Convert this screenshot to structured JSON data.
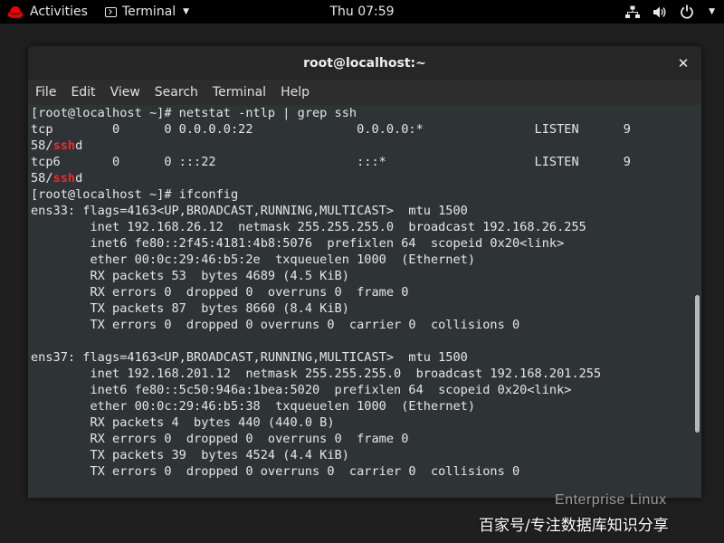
{
  "topbar": {
    "activities": "Activities",
    "app_name": "Terminal",
    "clock": "Thu 07:59"
  },
  "window": {
    "title": "root@localhost:~"
  },
  "menubar": {
    "items": [
      "File",
      "Edit",
      "View",
      "Search",
      "Terminal",
      "Help"
    ]
  },
  "terminal": {
    "lines": [
      [
        {
          "t": "[root@localhost ~]# netstat -ntlp | grep ssh"
        }
      ],
      [
        {
          "t": "tcp        0      0 0.0.0.0:22              0.0.0.0:*               LISTEN      9"
        }
      ],
      [
        {
          "t": "58/"
        },
        {
          "t": "ssh",
          "hl": true
        },
        {
          "t": "d"
        }
      ],
      [
        {
          "t": "tcp6       0      0 :::22                   :::*                    LISTEN      9"
        }
      ],
      [
        {
          "t": "58/"
        },
        {
          "t": "ssh",
          "hl": true
        },
        {
          "t": "d"
        }
      ],
      [
        {
          "t": "[root@localhost ~]# ifconfig"
        }
      ],
      [
        {
          "t": "ens33: flags=4163<UP,BROADCAST,RUNNING,MULTICAST>  mtu 1500"
        }
      ],
      [
        {
          "t": "        inet 192.168.26.12  netmask 255.255.255.0  broadcast 192.168.26.255"
        }
      ],
      [
        {
          "t": "        inet6 fe80::2f45:4181:4b8:5076  prefixlen 64  scopeid 0x20<link>"
        }
      ],
      [
        {
          "t": "        ether 00:0c:29:46:b5:2e  txqueuelen 1000  (Ethernet)"
        }
      ],
      [
        {
          "t": "        RX packets 53  bytes 4689 (4.5 KiB)"
        }
      ],
      [
        {
          "t": "        RX errors 0  dropped 0  overruns 0  frame 0"
        }
      ],
      [
        {
          "t": "        TX packets 87  bytes 8660 (8.4 KiB)"
        }
      ],
      [
        {
          "t": "        TX errors 0  dropped 0 overruns 0  carrier 0  collisions 0"
        }
      ],
      [
        {
          "t": ""
        }
      ],
      [
        {
          "t": "ens37: flags=4163<UP,BROADCAST,RUNNING,MULTICAST>  mtu 1500"
        }
      ],
      [
        {
          "t": "        inet 192.168.201.12  netmask 255.255.255.0  broadcast 192.168.201.255"
        }
      ],
      [
        {
          "t": "        inet6 fe80::5c50:946a:1bea:5020  prefixlen 64  scopeid 0x20<link>"
        }
      ],
      [
        {
          "t": "        ether 00:0c:29:46:b5:38  txqueuelen 1000  (Ethernet)"
        }
      ],
      [
        {
          "t": "        RX packets 4  bytes 440 (440.0 B)"
        }
      ],
      [
        {
          "t": "        RX errors 0  dropped 0  overruns 0  frame 0"
        }
      ],
      [
        {
          "t": "        TX packets 39  bytes 4524 (4.4 KiB)"
        }
      ],
      [
        {
          "t": "        TX errors 0  dropped 0 overruns 0  carrier 0  collisions 0"
        }
      ]
    ]
  },
  "watermark": {
    "os_text": "Enterprise Linux",
    "source_text": "百家号/专注数据库知识分享"
  },
  "icons": {
    "logo": "redhat-logo-icon",
    "network": "network-icon",
    "volume": "volume-icon",
    "power": "power-icon",
    "close": "close-icon"
  },
  "colors": {
    "topbar_bg": "#000000",
    "terminal_bg": "#2e3436",
    "terminal_fg": "#e6e6e6",
    "highlight": "#ef2929"
  }
}
